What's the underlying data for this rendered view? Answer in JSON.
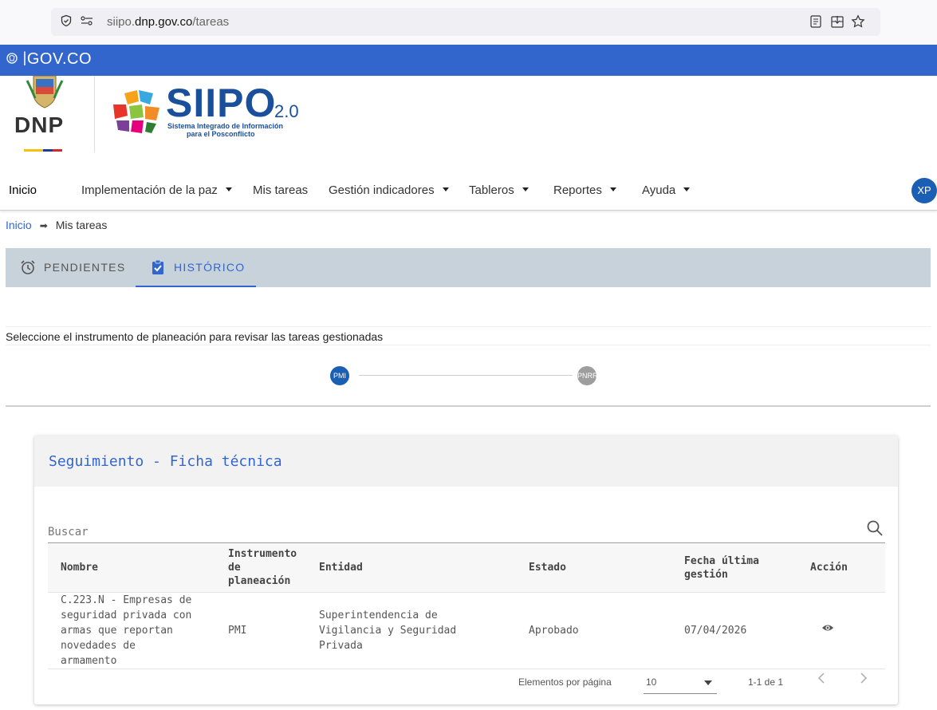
{
  "browser": {
    "url_prefix": "siipo.",
    "url_domain": "dnp.gov.co",
    "url_path": "/tareas"
  },
  "gov_bar": {
    "logo_text": "GOV.CO"
  },
  "header": {
    "dnp_text": "DNP",
    "siipo_title": "SIIPO",
    "siipo_version": "2.0",
    "siipo_subtitle_1": "Sistema Integrado de Información",
    "siipo_subtitle_2": "para el Posconflicto"
  },
  "nav": {
    "items": [
      {
        "label": "Inicio",
        "dropdown": false
      },
      {
        "label": "Implementación de la paz",
        "dropdown": true
      },
      {
        "label": "Mis tareas",
        "dropdown": false
      },
      {
        "label": "Gestión indicadores",
        "dropdown": true
      },
      {
        "label": "Tableros",
        "dropdown": true
      },
      {
        "label": "Reportes",
        "dropdown": true
      },
      {
        "label": "Ayuda",
        "dropdown": true
      }
    ],
    "avatar_initials": "XP"
  },
  "breadcrumb": {
    "home": "Inicio",
    "current": "Mis tareas"
  },
  "tabs": [
    {
      "label": "PENDIENTES",
      "active": false
    },
    {
      "label": "HISTÓRICO",
      "active": true
    }
  ],
  "instruction": "Seleccione el instrumento de planeación para revisar las tareas gestionadas",
  "stepper": [
    {
      "label": "PMI",
      "active": true
    },
    {
      "label": "PNRR",
      "active": false
    }
  ],
  "card": {
    "title": "Seguimiento - Ficha técnica",
    "search_placeholder": "Buscar",
    "columns": [
      "Nombre",
      "Instrumento de planeación",
      "Entidad",
      "Estado",
      "Fecha última gestión",
      "Acción"
    ],
    "rows": [
      {
        "nombre": "C.223.N - Empresas de seguridad privada con armas que reportan novedades de armamento",
        "instrumento": "PMI",
        "entidad": "Superintendencia de Vigilancia y Seguridad Privada",
        "estado": "Aprobado",
        "fecha": "07/04/2026",
        "accion_icon": "eye-icon"
      }
    ],
    "paginator": {
      "label": "Elementos por página",
      "page_size": "10",
      "range": "1-1 de 1"
    }
  },
  "colors": {
    "gov_blue": "#3366cc",
    "primary": "#1a5fb4",
    "tabs_bg": "#c8d2db"
  }
}
